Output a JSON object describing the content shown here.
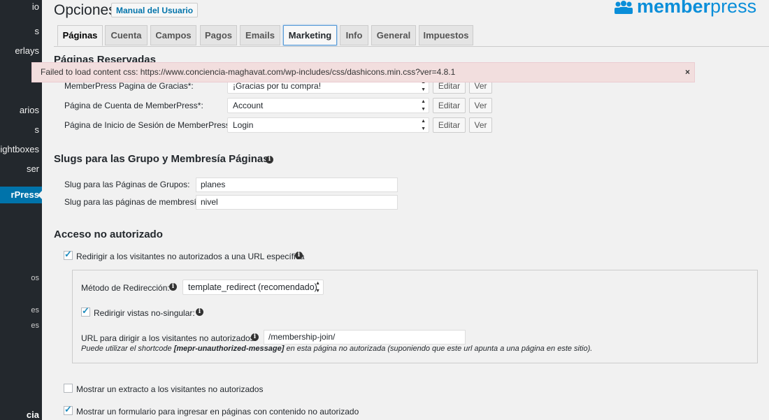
{
  "sidebar": {
    "items": [
      {
        "label": "io"
      },
      {
        "label": "s"
      },
      {
        "label": "erlays"
      },
      {
        "label": "arios"
      },
      {
        "label": "s"
      },
      {
        "label": "Lightboxes"
      },
      {
        "label": "ser"
      },
      {
        "label": "rPress"
      },
      {
        "label": "os"
      },
      {
        "label": "es"
      },
      {
        "label": "es"
      },
      {
        "label": "cia"
      }
    ]
  },
  "header": {
    "title": "Opciones",
    "manual_button": "Manual del Usuario",
    "logo_bold": "member",
    "logo_light": "press"
  },
  "tabs": [
    {
      "label": "Páginas"
    },
    {
      "label": "Cuenta"
    },
    {
      "label": "Campos"
    },
    {
      "label": "Pagos"
    },
    {
      "label": "Emails"
    },
    {
      "label": "Marketing"
    },
    {
      "label": "Info"
    },
    {
      "label": "General"
    },
    {
      "label": "Impuestos"
    }
  ],
  "error": {
    "message": "Failed to load content css: https://www.conciencia-maghavat.com/wp-includes/css/dashicons.min.css?ver=4.8.1",
    "close": "×"
  },
  "reserved": {
    "heading": "Páginas Reservadas",
    "rows": [
      {
        "label": "MemberPress Pagina de Gracias*:",
        "value": "¡Gracias por tu compra!",
        "edit": "Editar",
        "view": "Ver"
      },
      {
        "label": "Página de Cuenta de MemberPress*:",
        "value": "Account",
        "edit": "Editar",
        "view": "Ver"
      },
      {
        "label": "Página de Inicio de Sesión de MemberPress*:",
        "value": "Login",
        "edit": "Editar",
        "view": "Ver"
      }
    ]
  },
  "slugs": {
    "heading": "Slugs para las Grupo y Membresía Páginas:",
    "group_label": "Slug para las Páginas de Grupos:",
    "group_value": "planes",
    "membership_label": "Slug para las páginas de membresía:",
    "membership_value": "nivel"
  },
  "unauth": {
    "heading": "Acceso no autorizado",
    "redirect_label": "Redirigir a los visitantes no autorizados a una URL específica",
    "redirect_checked": true,
    "method_label": "Método de Redirección:",
    "method_value": "template_redirect (recomendado)",
    "nonsingular_label": "Redirigir vistas no-singular:",
    "nonsingular_checked": true,
    "url_label": "URL para dirigir a los visitantes no autorizados:",
    "url_value": "/membership-join/",
    "note_prefix": "Puede utilizar el shortcode ",
    "note_code": "[mepr-unauthorized-message]",
    "note_suffix": " en esta página no autorizada (suponiendo que este url apunta a una página en este sitio).",
    "excerpt_label": "Mostrar un extracto a los visitantes no autorizados",
    "excerpt_checked": false,
    "login_form_label": "Mostrar un formulario para ingresar en páginas con contenido no autorizado",
    "login_form_checked": true
  }
}
